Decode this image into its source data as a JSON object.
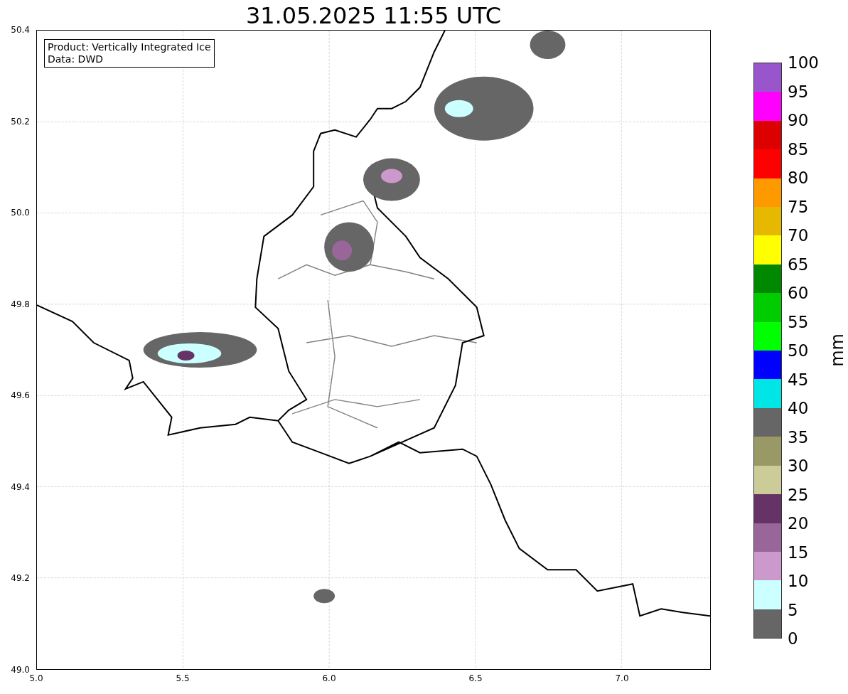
{
  "title": "31.05.2025 11:55 UTC",
  "legend": [
    "Product: Vertically Integrated Ice",
    "Data: DWD"
  ],
  "y_ticks": [
    "50.4",
    "50.2",
    "50.0",
    "49.8",
    "49.6",
    "49.4",
    "49.2",
    "49.0"
  ],
  "x_ticks": [
    "5.0",
    "5.5",
    "6.0",
    "6.5",
    "7.0"
  ],
  "colorbar": {
    "label": "mm",
    "ticks": [
      "100",
      "95",
      "90",
      "85",
      "80",
      "75",
      "70",
      "65",
      "60",
      "55",
      "50",
      "45",
      "40",
      "35",
      "30",
      "25",
      "20",
      "15",
      "10",
      "5",
      "0"
    ],
    "bands": [
      {
        "color": "#9955cc"
      },
      {
        "color": "#ff00ff"
      },
      {
        "color": "#dd0000"
      },
      {
        "color": "#ff0000"
      },
      {
        "color": "#ff9900"
      },
      {
        "color": "#e6b800"
      },
      {
        "color": "#ffff00"
      },
      {
        "color": "#008800"
      },
      {
        "color": "#00cc00"
      },
      {
        "color": "#00ff00"
      },
      {
        "color": "#0000ff"
      },
      {
        "color": "#00e6e6"
      },
      {
        "color": "#666666"
      },
      {
        "color": "#999966"
      },
      {
        "color": "#cccc99"
      },
      {
        "color": "#663366"
      },
      {
        "color": "#996699"
      },
      {
        "color": "#cc99cc"
      },
      {
        "color": "#ccffff"
      },
      {
        "color": "#666666"
      }
    ]
  }
}
